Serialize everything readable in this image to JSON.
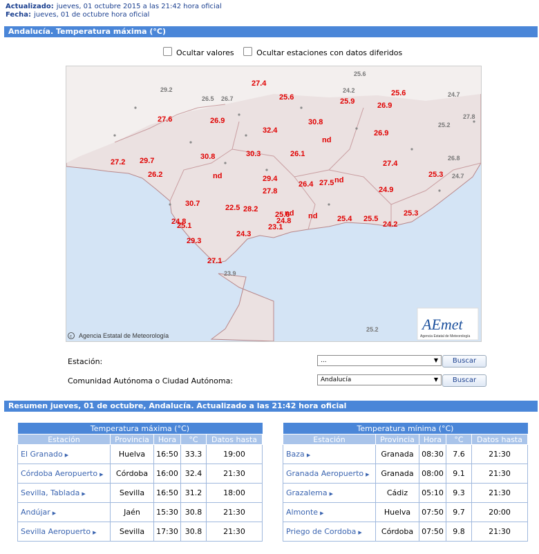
{
  "header": {
    "updated_label": "Actualizado:",
    "updated_value": "jueves, 01 octubre 2015 a las 21:42 hora oficial",
    "date_label": "Fecha:",
    "date_value": "jueves, 01 de octubre hora oficial"
  },
  "section_title": "Andalucía. Temperatura máxima (°C)",
  "options": {
    "hide_values": "Ocultar valores",
    "hide_delayed": "Ocultar estaciones con datos diferidos"
  },
  "map": {
    "copyright": "Agencia Estatal de Meteorología",
    "logo_text": "AEmet",
    "logo_sub": "Agencia Estatal de Meteorología",
    "red_values": [
      "27.4",
      "25.6",
      "25.6",
      "25.9",
      "26.9",
      "27.6",
      "26.9",
      "32.4",
      "30.8",
      "nd",
      "26.9",
      "30.8",
      "30.3",
      "26.1",
      "27.2",
      "29.7",
      "26.2",
      "nd",
      "29.4",
      "27.4",
      "26.4",
      "27.5",
      "nd",
      "25.3",
      "27.8",
      "24.9",
      "30.7",
      "22.5",
      "28.2",
      "25.6",
      "nd",
      "25.3",
      "24.8",
      "25.1",
      "24.8",
      "nd",
      "25.4",
      "25.5",
      "24.2",
      "24.3",
      "23.1",
      "29.3",
      "27.1"
    ],
    "grey_values": [
      "25.6",
      "29.2",
      "24.2",
      "26.5",
      "26.7",
      "24.7",
      "27.8",
      "25.2",
      "26.8",
      "24.7",
      "23.9",
      "25.2"
    ]
  },
  "form": {
    "station_label": "Estación:",
    "station_value": "...",
    "community_label": "Comunidad Autónoma o Ciudad Autónoma:",
    "community_value": "Andalucía",
    "search_label": "Buscar"
  },
  "summary_title": "Resumen jueves, 01 de octubre, Andalucía. Actualizado a las 21:42 hora oficial",
  "tables": {
    "headers": [
      "Estación",
      "Provincia",
      "Hora",
      "°C",
      "Datos hasta"
    ],
    "max": {
      "title": "Temperatura máxima (°C)",
      "rows": [
        [
          "El Granado",
          "Huelva",
          "16:50",
          "33.3",
          "19:00"
        ],
        [
          "Córdoba Aeropuerto",
          "Córdoba",
          "16:00",
          "32.4",
          "21:30"
        ],
        [
          "Sevilla, Tablada",
          "Sevilla",
          "16:50",
          "31.2",
          "18:00"
        ],
        [
          "Andújar",
          "Jaén",
          "15:30",
          "30.8",
          "21:30"
        ],
        [
          "Sevilla Aeropuerto",
          "Sevilla",
          "17:30",
          "30.8",
          "21:30"
        ]
      ]
    },
    "min": {
      "title": "Temperatura mínima (°C)",
      "rows": [
        [
          "Baza",
          "Granada",
          "08:30",
          "7.6",
          "21:30"
        ],
        [
          "Granada Aeropuerto",
          "Granada",
          "08:00",
          "9.1",
          "21:30"
        ],
        [
          "Grazalema",
          "Cádiz",
          "05:10",
          "9.3",
          "21:30"
        ],
        [
          "Almonte",
          "Huelva",
          "07:50",
          "9.7",
          "20:00"
        ],
        [
          "Priego de Cordoba",
          "Córdoba",
          "07:50",
          "9.8",
          "21:30"
        ]
      ]
    }
  }
}
